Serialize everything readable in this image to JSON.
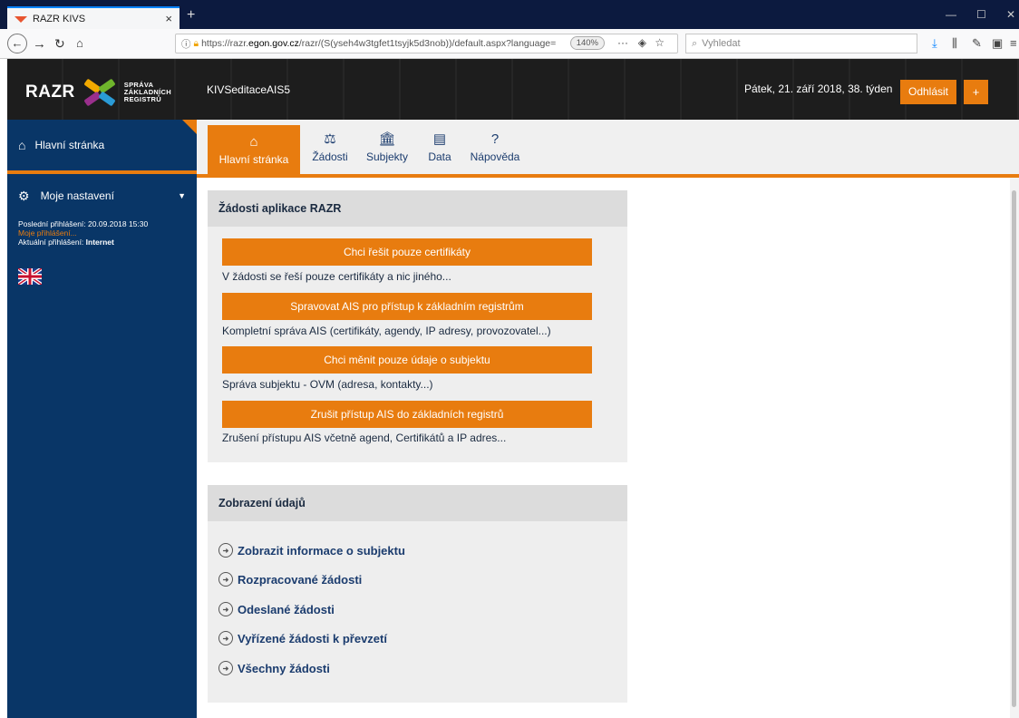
{
  "browser": {
    "tab_title": "RAZR KIVS",
    "url_prefix": "https://razr.",
    "url_domain": "egon.gov.cz",
    "url_suffix": "/razr/(S(yseh4w3tgfet1tsyjk5d3nob))/default.aspx?language=",
    "zoom": "140%",
    "search_placeholder": "Vyhledat"
  },
  "header": {
    "logo_text": "RAZR",
    "logo_sub1": "SPRÁVA",
    "logo_sub2": "ZÁKLADNÍCH",
    "logo_sub3": "REGISTRŮ",
    "app_name": "KIVSeditaceAIS5",
    "date": "Pátek, 21. září 2018, 38. týden",
    "logout": "Odhlásit",
    "plus": "+"
  },
  "sidebar": {
    "home": "Hlavní stránka",
    "settings": "Moje nastavení",
    "last_login_label": "Poslední přihlášení:",
    "last_login_value": "20.09.2018 15:30",
    "my_logins": "Moje přihlášení...",
    "current_login_label": "Aktuální přihlášení:",
    "current_login_value": "Internet"
  },
  "menu": {
    "items": [
      {
        "label": "Hlavní stránka"
      },
      {
        "label": "Žádosti"
      },
      {
        "label": "Subjekty"
      },
      {
        "label": "Data"
      },
      {
        "label": "Nápověda"
      }
    ]
  },
  "requests_panel": {
    "title": "Žádosti aplikace RAZR",
    "items": [
      {
        "button": "Chci řešit pouze certifikáty",
        "desc": "V žádosti se řeší pouze certifikáty a nic jiného..."
      },
      {
        "button": "Spravovat AIS pro přístup k základním registrům",
        "desc": "Kompletní správa AIS (certifikáty, agendy, IP adresy, provozovatel...)"
      },
      {
        "button": "Chci měnit pouze údaje o subjektu",
        "desc": "Správa subjektu - OVM (adresa, kontakty...)"
      },
      {
        "button": "Zrušit přístup AIS do základních registrů",
        "desc": "Zrušení přístupu AIS včetně agend, Certifikátů a IP adres..."
      }
    ]
  },
  "data_panel": {
    "title": "Zobrazení údajů",
    "links": [
      "Zobrazit informace o subjektu",
      "Rozpracované žádosti",
      "Odeslané žádosti",
      "Vyřízené žádosti k převzetí",
      "Všechny žádosti"
    ]
  },
  "colors": {
    "accent": "#e87c0f",
    "sidebar": "#093667",
    "header": "#1f1f1f"
  },
  "icons": {
    "home": "home-icon",
    "settings": "gear-icon",
    "requests": "gavel-icon",
    "subjects": "bank-icon",
    "data": "clipboard-icon",
    "help": "question-icon",
    "link": "circle-arrow-icon"
  }
}
